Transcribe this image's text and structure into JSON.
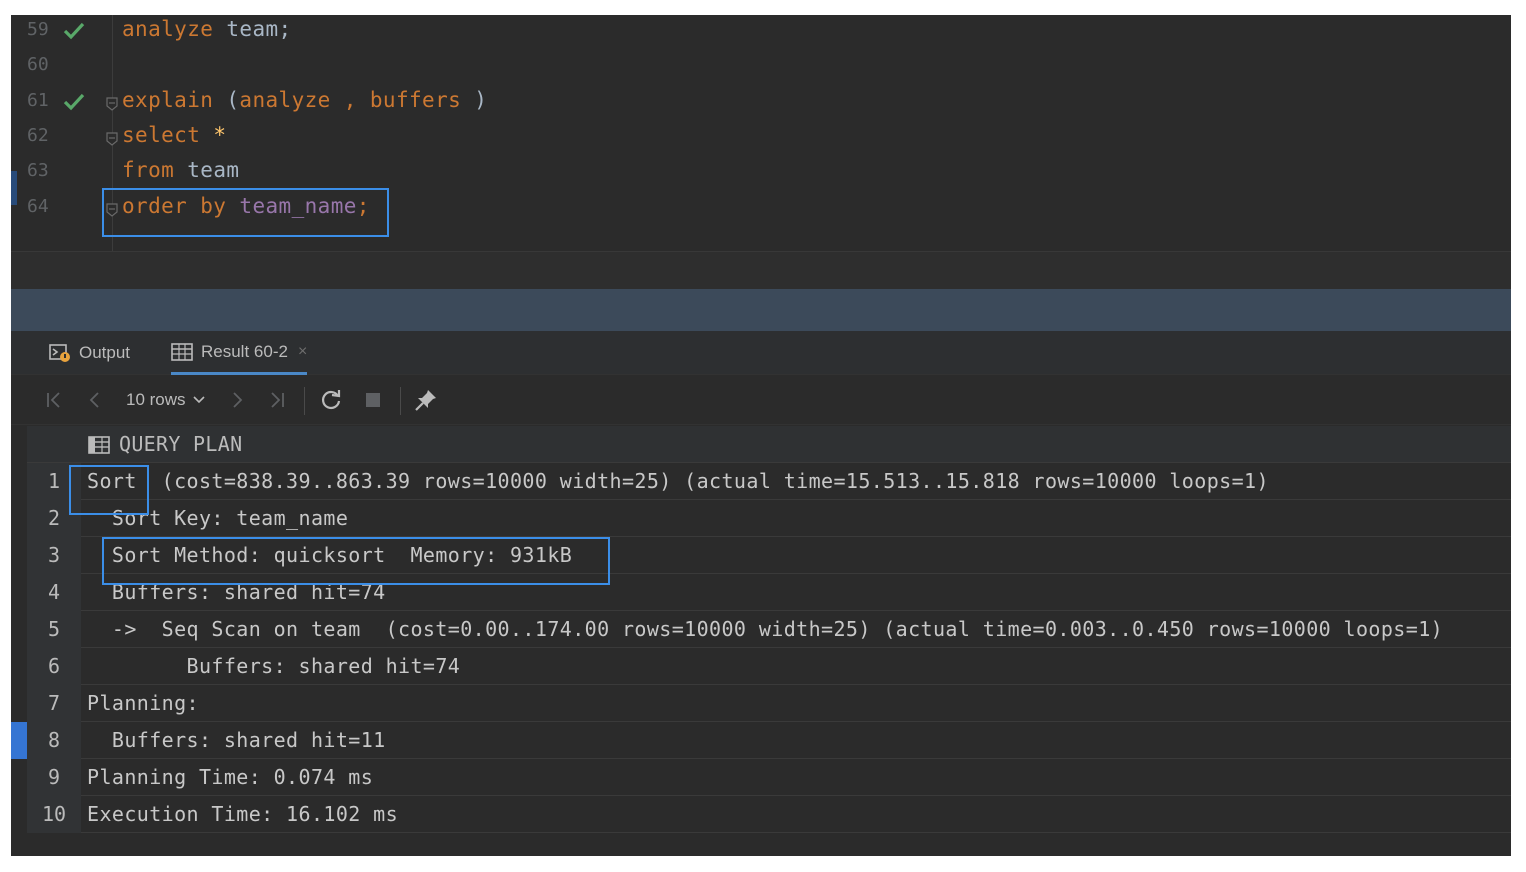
{
  "editor": {
    "lines": [
      {
        "num": "59",
        "status": "success",
        "tokens": [
          {
            "t": "analyze",
            "c": "kw"
          },
          {
            "t": " team;",
            "c": ""
          }
        ]
      },
      {
        "num": "60",
        "status": "",
        "tokens": []
      },
      {
        "num": "61",
        "status": "success",
        "fold": true,
        "tokens": [
          {
            "t": "explain",
            "c": "kw"
          },
          {
            "t": " (",
            "c": ""
          },
          {
            "t": "analyze",
            "c": "kw"
          },
          {
            "t": " , ",
            "c": "kw"
          },
          {
            "t": "buffers",
            "c": "kw"
          },
          {
            "t": " )",
            "c": ""
          }
        ]
      },
      {
        "num": "62",
        "status": "",
        "fold": true,
        "tokens": [
          {
            "t": "select",
            "c": "kw"
          },
          {
            "t": " ",
            "c": ""
          },
          {
            "t": "*",
            "c": "star"
          }
        ]
      },
      {
        "num": "63",
        "status": "",
        "tokens": [
          {
            "t": "from",
            "c": "kw"
          },
          {
            "t": " team",
            "c": ""
          }
        ]
      },
      {
        "num": "64",
        "status": "",
        "fold": true,
        "tokens": [
          {
            "t": "order by",
            "c": "kw"
          },
          {
            "t": " ",
            "c": ""
          },
          {
            "t": "team_name",
            "c": "col"
          },
          {
            "t": ";",
            "c": "kw"
          }
        ]
      }
    ]
  },
  "tabs": {
    "output_label": "Output",
    "result_label": "Result 60-2",
    "close_glyph": "×"
  },
  "toolbar": {
    "rows_label": "10 rows"
  },
  "grid": {
    "column_header": "QUERY PLAN",
    "rows": [
      {
        "num": "1",
        "text": "Sort  (cost=838.39..863.39 rows=10000 width=25) (actual time=15.513..15.818 rows=10000 loops=1)"
      },
      {
        "num": "2",
        "text": "  Sort Key: team_name"
      },
      {
        "num": "3",
        "text": "  Sort Method: quicksort  Memory: 931kB"
      },
      {
        "num": "4",
        "text": "  Buffers: shared hit=74"
      },
      {
        "num": "5",
        "text": "  ->  Seq Scan on team  (cost=0.00..174.00 rows=10000 width=25) (actual time=0.003..0.450 rows=10000 loops=1)"
      },
      {
        "num": "6",
        "text": "        Buffers: shared hit=74"
      },
      {
        "num": "7",
        "text": "Planning:"
      },
      {
        "num": "8",
        "text": "  Buffers: shared hit=11"
      },
      {
        "num": "9",
        "text": "Planning Time: 0.074 ms"
      },
      {
        "num": "10",
        "text": "Execution Time: 16.102 ms"
      }
    ],
    "selected_row": "8"
  },
  "colors": {
    "keyword": "#cc7832",
    "column": "#9876aa",
    "highlight": "#3b8ee8",
    "success_check": "#59a869",
    "row_marker": "#3575d3"
  },
  "icons": [
    "check-icon",
    "fold-icon",
    "output-console-icon",
    "table-icon",
    "first-page-icon",
    "prev-page-icon",
    "chevron-down-icon",
    "next-page-icon",
    "last-page-icon",
    "refresh-icon",
    "stop-icon",
    "pin-icon",
    "column-table-icon"
  ]
}
